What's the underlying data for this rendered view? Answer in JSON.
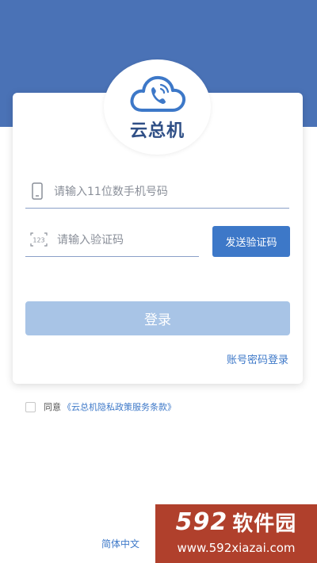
{
  "app": {
    "name": "云总机"
  },
  "form": {
    "phone_placeholder": "请输入11位数手机号码",
    "code_placeholder": "请输入验证码",
    "send_code_label": "发送验证码",
    "login_label": "登录",
    "password_login_label": "账号密码登录"
  },
  "agreement": {
    "prefix": "同意",
    "link_text": "《云总机隐私政策服务条款》",
    "checked": false
  },
  "footer": {
    "language_label": "简体中文"
  },
  "watermark": {
    "brand_number": "592",
    "brand_text": "软件园",
    "url": "www.592xiazai.com"
  },
  "colors": {
    "banner": "#4a72b6",
    "accent": "#3d78c8",
    "login_button_disabled": "#a8c4e6",
    "logo_text": "#2f4f86"
  },
  "icons": {
    "logo": "cloud-phone-icon",
    "phone_field": "mobile-phone-icon",
    "code_field": "numeric-code-icon",
    "agreement": "checkbox"
  }
}
